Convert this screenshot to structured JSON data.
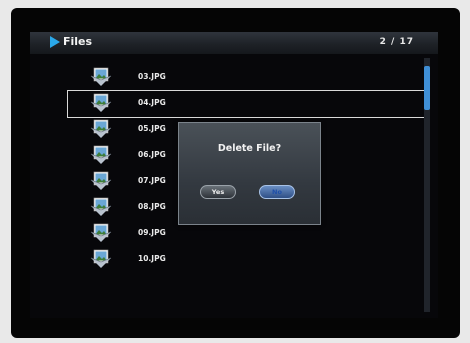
{
  "header": {
    "title": "Files",
    "page_indicator": "2  /  17"
  },
  "files": [
    {
      "name": "03.JPG",
      "icon": "photo-file-icon",
      "selected": false
    },
    {
      "name": "04.JPG",
      "icon": "photo-file-icon",
      "selected": true
    },
    {
      "name": "05.JPG",
      "icon": "photo-file-icon",
      "selected": false
    },
    {
      "name": "06.JPG",
      "icon": "photo-file-icon",
      "selected": false
    },
    {
      "name": "07.JPG",
      "icon": "photo-file-icon",
      "selected": false
    },
    {
      "name": "08.JPG",
      "icon": "photo-file-icon",
      "selected": false
    },
    {
      "name": "09.JPG",
      "icon": "photo-file-icon",
      "selected": false
    },
    {
      "name": "10.JPG",
      "icon": "photo-file-icon",
      "selected": false
    }
  ],
  "dialog": {
    "title": "Delete File?",
    "yes_label": "Yes",
    "no_label": "No",
    "focused_button": "No"
  },
  "colors": {
    "accent": "#2aa8ea",
    "scroll_thumb": "#3f8fd6",
    "background": "#07070a"
  }
}
